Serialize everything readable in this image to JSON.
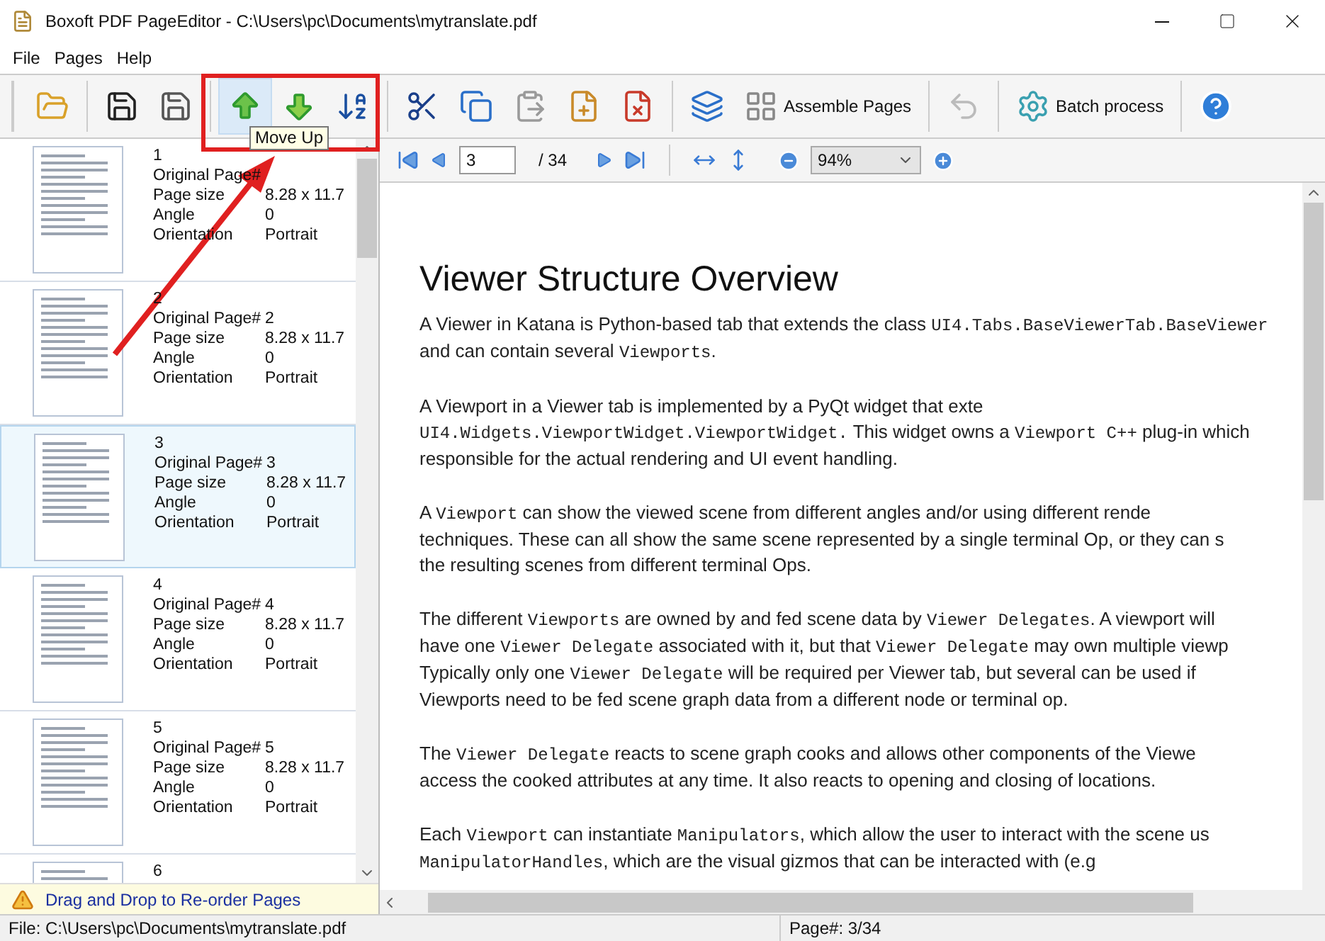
{
  "window": {
    "title": "Boxoft PDF PageEditor - C:\\Users\\pc\\Documents\\mytranslate.pdf"
  },
  "menu": [
    "File",
    "Pages",
    "Help"
  ],
  "toolbar": {
    "buttons": [
      {
        "hovered": false
      },
      {
        "hovered": false
      },
      {
        "hovered": false
      },
      {
        "hovered": true
      },
      {
        "hovered": false
      },
      {
        "hovered": false
      },
      {
        "hovered": false
      },
      {
        "hovered": false
      },
      {
        "hovered": false
      },
      {
        "hovered": false
      },
      {
        "hovered": false
      },
      {
        "hovered": false
      },
      {
        "hovered": false,
        "label": "Assemble Pages"
      },
      {
        "hovered": false
      },
      {
        "hovered": false,
        "label": "Batch process"
      },
      {
        "hovered": false
      }
    ]
  },
  "tooltip": {
    "text": "Move Up"
  },
  "sidebar": {
    "pages": [
      {
        "number": "1",
        "selected": false,
        "rows": [
          {
            "label": "Original Page#"
          },
          {
            "label": "Page size",
            "value": "8.28 x 11.7"
          },
          {
            "label": "Angle",
            "value": "0"
          },
          {
            "label": "Orientation",
            "value": "Portrait"
          }
        ]
      },
      {
        "number": "2",
        "selected": false,
        "rows": [
          {
            "label": "Original Page#",
            "value": "2"
          },
          {
            "label": "Page size",
            "value": "8.28 x 11.7"
          },
          {
            "label": "Angle",
            "value": "0"
          },
          {
            "label": "Orientation",
            "value": "Portrait"
          }
        ]
      },
      {
        "number": "3",
        "selected": true,
        "rows": [
          {
            "label": "Original Page#",
            "value": "3"
          },
          {
            "label": "Page size",
            "value": "8.28 x 11.7"
          },
          {
            "label": "Angle",
            "value": "0"
          },
          {
            "label": "Orientation",
            "value": "Portrait"
          }
        ]
      },
      {
        "number": "4",
        "selected": false,
        "rows": [
          {
            "label": "Original Page#",
            "value": "4"
          },
          {
            "label": "Page size",
            "value": "8.28 x 11.7"
          },
          {
            "label": "Angle",
            "value": "0"
          },
          {
            "label": "Orientation",
            "value": "Portrait"
          }
        ]
      },
      {
        "number": "5",
        "selected": false,
        "rows": [
          {
            "label": "Original Page#",
            "value": "5"
          },
          {
            "label": "Page size",
            "value": "8.28 x 11.7"
          },
          {
            "label": "Angle",
            "value": "0"
          },
          {
            "label": "Orientation",
            "value": "Portrait"
          }
        ]
      },
      {
        "number": "6",
        "selected": false
      }
    ],
    "hint": "Drag and Drop to Re-order Pages"
  },
  "navigation": {
    "page": "3",
    "total": "/ 34",
    "zoom": "94%"
  },
  "document": {
    "title": "Viewer Structure Overview",
    "paragraphs": [
      [
        [
          {
            "kind": "text",
            "text": "A Viewer in Katana is Python-based tab that extends the class "
          },
          {
            "kind": "code",
            "text": "UI4.Tabs.BaseViewerTab.BaseViewer"
          }
        ],
        [
          {
            "kind": "text",
            "text": "and can contain several "
          },
          {
            "kind": "code",
            "text": "Viewports"
          },
          {
            "kind": "text",
            "text": "."
          }
        ]
      ],
      [
        [
          {
            "kind": "text",
            "text": "A Viewport in a Viewer tab is implemented by a PyQt widget that exte"
          }
        ],
        [
          {
            "kind": "code",
            "text": "UI4.Widgets.ViewportWidget.ViewportWidget."
          },
          {
            "kind": "text",
            "text": " This widget owns a "
          },
          {
            "kind": "code",
            "text": "Viewport C++"
          },
          {
            "kind": "text",
            "text": " plug-in which"
          }
        ],
        [
          {
            "kind": "text",
            "text": "responsible for the actual rendering and UI event handling."
          }
        ]
      ],
      [
        [
          {
            "kind": "text",
            "text": "A "
          },
          {
            "kind": "code",
            "text": "Viewport"
          },
          {
            "kind": "text",
            "text": " can show the viewed scene from different angles and/or using different rende"
          }
        ],
        [
          {
            "kind": "text",
            "text": "techniques. These can all show the same scene represented by a single terminal Op, or they can s"
          }
        ],
        [
          {
            "kind": "text",
            "text": "the resulting scenes from different terminal Ops."
          }
        ]
      ],
      [
        [
          {
            "kind": "text",
            "text": "The different "
          },
          {
            "kind": "code",
            "text": "Viewports"
          },
          {
            "kind": "text",
            "text": " are owned by and fed scene data by "
          },
          {
            "kind": "code",
            "text": "Viewer Delegates"
          },
          {
            "kind": "text",
            "text": ". A viewport will"
          }
        ],
        [
          {
            "kind": "text",
            "text": "have one "
          },
          {
            "kind": "code",
            "text": "Viewer Delegate"
          },
          {
            "kind": "text",
            "text": " associated with it, but that "
          },
          {
            "kind": "code",
            "text": "Viewer Delegate"
          },
          {
            "kind": "text",
            "text": " may own multiple viewp"
          }
        ],
        [
          {
            "kind": "text",
            "text": "Typically only one "
          },
          {
            "kind": "code",
            "text": "Viewer Delegate"
          },
          {
            "kind": "text",
            "text": " will be required per Viewer tab, but several can be used if"
          }
        ],
        [
          {
            "kind": "text",
            "text": "Viewports need to be fed scene graph data from a different node or terminal op."
          }
        ]
      ],
      [
        [
          {
            "kind": "text",
            "text": "The "
          },
          {
            "kind": "code",
            "text": "Viewer Delegate"
          },
          {
            "kind": "text",
            "text": " reacts to scene graph cooks and allows other components of the Viewe"
          }
        ],
        [
          {
            "kind": "text",
            "text": "access the cooked attributes at any time. It also reacts to opening and closing of locations."
          }
        ]
      ],
      [
        [
          {
            "kind": "text",
            "text": "Each "
          },
          {
            "kind": "code",
            "text": "Viewport"
          },
          {
            "kind": "text",
            "text": " can instantiate "
          },
          {
            "kind": "code",
            "text": "Manipulators"
          },
          {
            "kind": "text",
            "text": ", which allow the user to interact with the scene us"
          }
        ],
        [
          {
            "kind": "code",
            "text": "ManipulatorHandles"
          },
          {
            "kind": "text",
            "text": ", which are the visual gizmos that can be interacted with (e.g"
          }
        ]
      ]
    ]
  },
  "status_bar": {
    "file": "File: C:\\Users\\pc\\Documents\\mytranslate.pdf",
    "page": "Page#: 3/34"
  }
}
